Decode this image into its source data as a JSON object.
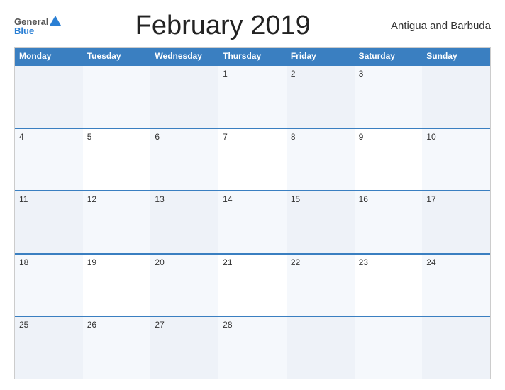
{
  "header": {
    "logo_general": "General",
    "logo_blue": "Blue",
    "title": "February 2019",
    "country": "Antigua and Barbuda"
  },
  "calendar": {
    "weekdays": [
      "Monday",
      "Tuesday",
      "Wednesday",
      "Thursday",
      "Friday",
      "Saturday",
      "Sunday"
    ],
    "weeks": [
      [
        "",
        "",
        "",
        "1",
        "2",
        "3",
        ""
      ],
      [
        "4",
        "5",
        "6",
        "7",
        "8",
        "9",
        "10"
      ],
      [
        "11",
        "12",
        "13",
        "14",
        "15",
        "16",
        "17"
      ],
      [
        "18",
        "19",
        "20",
        "21",
        "22",
        "23",
        "24"
      ],
      [
        "25",
        "26",
        "27",
        "28",
        "",
        "",
        ""
      ]
    ]
  }
}
